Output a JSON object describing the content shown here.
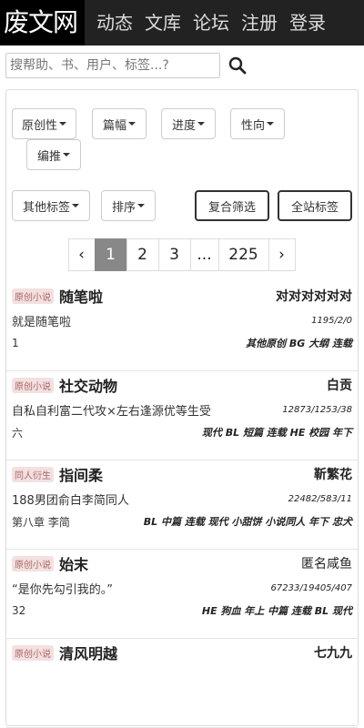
{
  "header": {
    "logo": "废文网",
    "nav": [
      "动态",
      "文库",
      "论坛",
      "注册",
      "登录"
    ]
  },
  "search": {
    "placeholder": "搜帮助、书、用户、标签...?"
  },
  "filters": {
    "row1": [
      "原创性",
      "篇幅",
      "进度",
      "性向",
      "编推"
    ],
    "row2": [
      "其他标签",
      "排序"
    ],
    "composite": "复合筛选",
    "all_tags": "全站标签"
  },
  "pagination": {
    "prev": "‹",
    "pages": [
      "1",
      "2",
      "3",
      "...",
      "225"
    ],
    "next": "›"
  },
  "threads": [
    {
      "tag": "原创小说",
      "title": "随笔啦",
      "author": "对对对对对对",
      "summary": "就是随笔啦",
      "stats": "1195/2/0",
      "chapter": "1",
      "tags": "其他原创 BG 大纲 连载"
    },
    {
      "tag": "原创小说",
      "title": "社交动物",
      "author": "白贡",
      "summary": "自私自利富二代攻×左右逢源优等生受",
      "stats": "12873/1253/38",
      "chapter": "六",
      "tags": "现代 BL 短篇 连载 HE 校园 年下"
    },
    {
      "tag": "同人衍生",
      "title": "指间柔",
      "author": "靳繁花",
      "summary": "188男团俞白李简同人",
      "stats": "22482/583/11",
      "chapter": "第八章 李简",
      "tags": "BL 中篇 连载 现代 小甜饼 小说同人 年下 忠犬"
    },
    {
      "tag": "原创小说",
      "title": "始末",
      "author": "匿名咸鱼",
      "summary": "“是你先勾引我的。”",
      "stats": "67233/19405/407",
      "chapter": "32",
      "tags": "HE 狗血 年上 中篇 连载 BL 现代"
    },
    {
      "tag": "原创小说",
      "title": "清风明越",
      "author": "七九九",
      "summary": "",
      "stats": "",
      "chapter": "",
      "tags": ""
    }
  ]
}
